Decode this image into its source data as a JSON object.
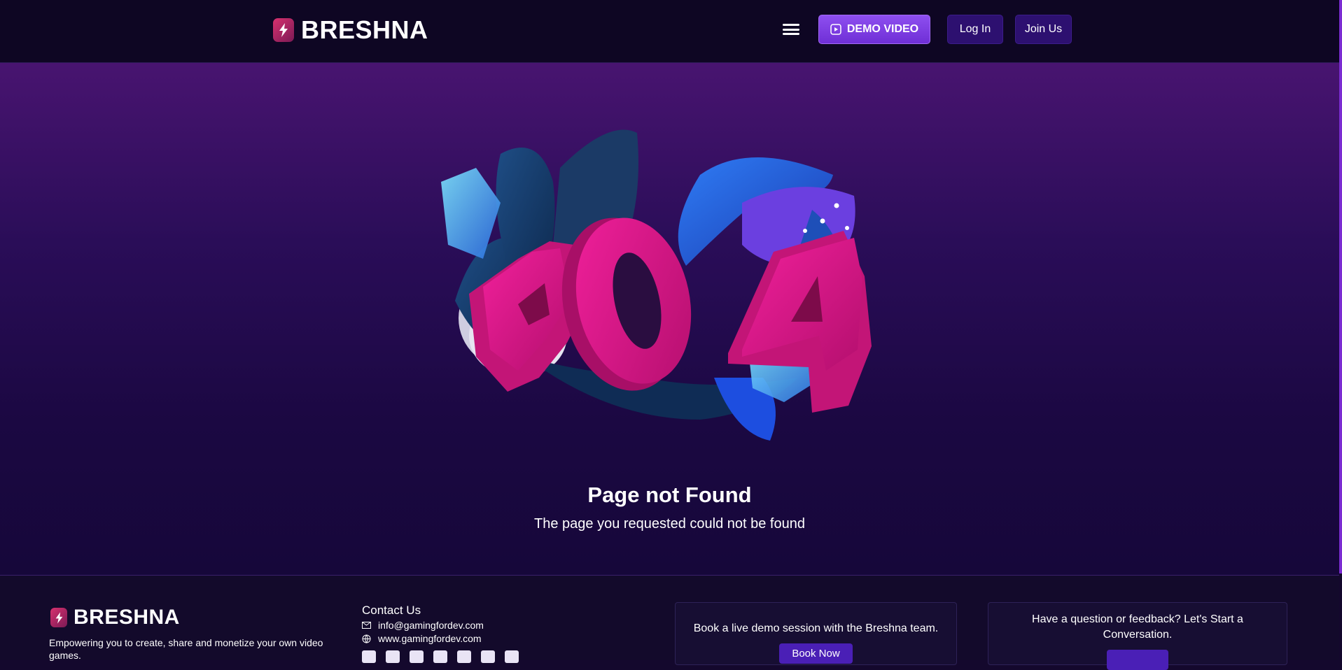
{
  "header": {
    "brand": "BRESHNA",
    "demo_label": "DEMO VIDEO",
    "login_label": "Log In",
    "join_label": "Join Us"
  },
  "main": {
    "error_code": "404",
    "title": "Page not Found",
    "subtitle": "The page you requested could not be found"
  },
  "footer": {
    "brand": "BRESHNA",
    "tagline": "Empowering you to create, share and monetize your own video games.",
    "contact_heading": "Contact Us",
    "email": "info@gamingfordev.com",
    "website": "www.gamingfordev.com",
    "socials": [
      "youtube-icon",
      "discord-icon",
      "tiktok-icon",
      "facebook-icon",
      "instagram-icon",
      "linkedin-icon",
      "twitter-icon"
    ],
    "demo_card_text": "Book a live demo session with the Breshna team.",
    "demo_card_button": "Book Now",
    "feedback_card_text": "Have a question or feedback? Let's Start a Conversation."
  },
  "colors": {
    "accent": "#7b3fe4",
    "brand_mark": "#c62a6b",
    "pink_404": "#e0168a",
    "header_bg": "#0e0623"
  }
}
